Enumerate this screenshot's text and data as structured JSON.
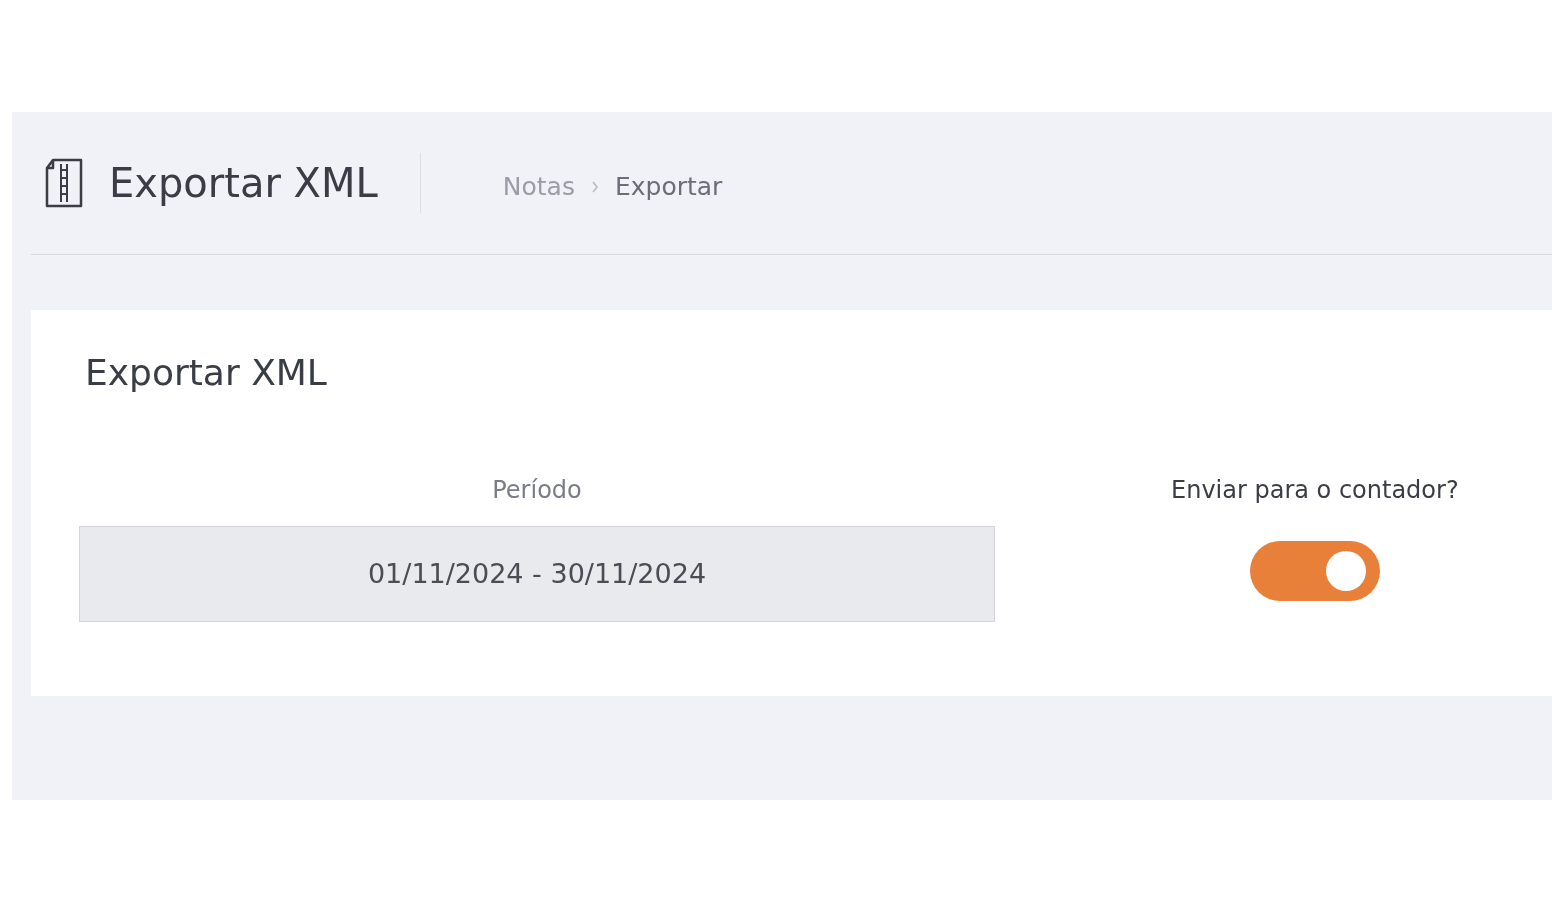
{
  "header": {
    "title": "Exportar XML",
    "breadcrumb": [
      {
        "label": "Notas"
      },
      {
        "label": "Exportar"
      }
    ]
  },
  "card": {
    "title": "Exportar XML",
    "period": {
      "label": "Período",
      "value": "01/11/2024 - 30/11/2024"
    },
    "send_to_accountant": {
      "label": "Enviar para o contador?",
      "on": true
    }
  }
}
